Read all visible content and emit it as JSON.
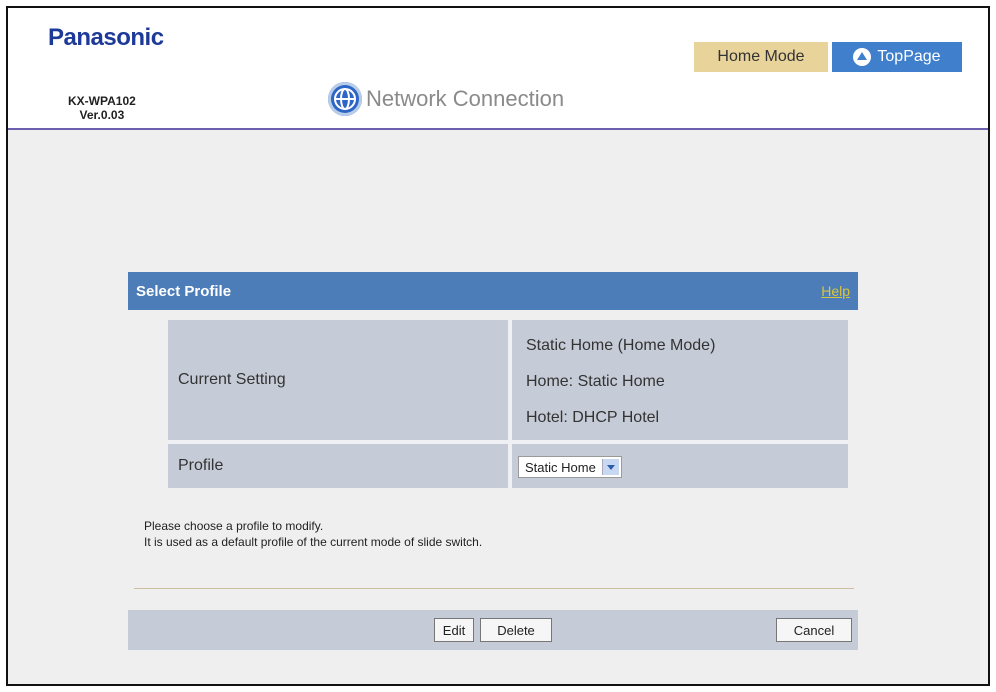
{
  "header": {
    "brand": "Panasonic",
    "model": "KX-WPA102",
    "version": "Ver.0.03",
    "page_title": "Network Connection",
    "home_mode_label": "Home Mode",
    "top_page_label": "TopPage"
  },
  "panel": {
    "title": "Select Profile",
    "help": "Help",
    "rows": {
      "current_setting_label": "Current Setting",
      "current_setting_values": [
        "Static Home (Home Mode)",
        "Home: Static Home",
        "Hotel: DHCP Hotel"
      ],
      "profile_label": "Profile",
      "profile_selected": "Static Home"
    },
    "instructions": [
      "Please choose a profile to modify.",
      "It is used as a default profile of the current mode of slide switch."
    ],
    "buttons": {
      "edit": "Edit",
      "delete": "Delete",
      "cancel": "Cancel"
    }
  },
  "colors": {
    "accent": "#4d7db8",
    "home_mode_bg": "#e8d39b",
    "top_page_bg": "#3f7fcb",
    "row_bg": "#c6ccd7",
    "brand": "#1e3a98"
  },
  "icons": {
    "globe": "globe-icon",
    "up_arrow": "up-arrow-icon",
    "dropdown": "chevron-down-icon"
  }
}
